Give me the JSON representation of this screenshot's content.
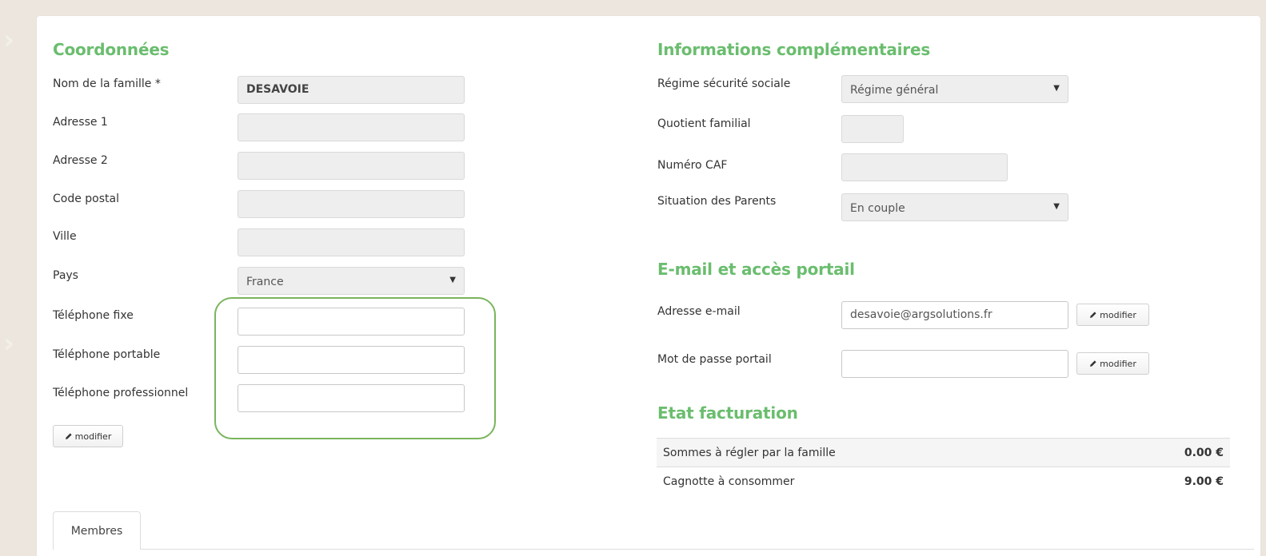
{
  "coordonnees": {
    "title": "Coordonnées",
    "fields": [
      {
        "label": "Nom de la famille *",
        "value": "DESAVOIE"
      },
      {
        "label": "Adresse 1",
        "value": ""
      },
      {
        "label": "Adresse 2",
        "value": ""
      },
      {
        "label": "Code postal",
        "value": ""
      },
      {
        "label": "Ville",
        "value": ""
      },
      {
        "label": "Pays",
        "value": "France"
      },
      {
        "label": "Téléphone fixe",
        "value": ""
      },
      {
        "label": "Téléphone portable",
        "value": ""
      },
      {
        "label": "Téléphone professionnel",
        "value": ""
      }
    ],
    "modify_label": "modifier"
  },
  "infos": {
    "title": "Informations complémentaires",
    "fields": [
      {
        "label": "Régime sécurité sociale",
        "value": "Régime général"
      },
      {
        "label": "Quotient familial",
        "value": ""
      },
      {
        "label": "Numéro CAF",
        "value": ""
      },
      {
        "label": "Situation des Parents",
        "value": "En couple"
      }
    ]
  },
  "email": {
    "title": "E-mail et accès portail",
    "email_label": "Adresse e-mail",
    "email_value": "desavoie@argsolutions.fr",
    "password_label": "Mot de passe portail",
    "password_value": "",
    "modify_label": "modifier"
  },
  "facturation": {
    "title": "Etat facturation",
    "rows": [
      {
        "label": "Sommes à régler par la famille",
        "amount": "0.00 €"
      },
      {
        "label": "Cagnotte à consommer",
        "amount": "9.00 €"
      }
    ]
  },
  "tabs": [
    {
      "label": "Membres"
    }
  ],
  "colors": {
    "accent": "#6abd6e",
    "highlight": "#7ab55c",
    "background": "#ece6df"
  }
}
